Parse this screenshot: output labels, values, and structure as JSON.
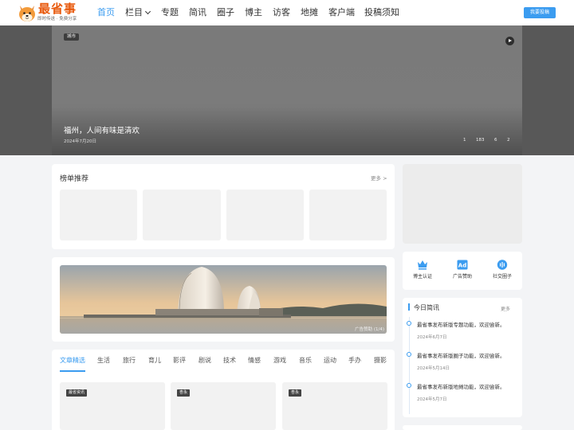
{
  "logo": {
    "title": "最省事",
    "slogan": "即时传送 · 免费分享"
  },
  "nav": {
    "items": [
      {
        "label": "首页",
        "active": true
      },
      {
        "label": "栏目",
        "has_dropdown": true
      },
      {
        "label": "专题"
      },
      {
        "label": "简讯"
      },
      {
        "label": "圈子"
      },
      {
        "label": "博主"
      },
      {
        "label": "访客"
      },
      {
        "label": "地摊"
      },
      {
        "label": "客户端"
      },
      {
        "label": "投稿须知"
      }
    ],
    "submit_button": "我要投稿"
  },
  "hero": {
    "tag": "城市",
    "title": "福州，人间有味是清欢",
    "date": "2024年7月20日",
    "stats": [
      "1",
      "183",
      "6",
      "2"
    ]
  },
  "ranking": {
    "title": "榜单推荐",
    "more": "更多 >"
  },
  "ad_banner": {
    "label": "广告赞助 (1/4)"
  },
  "article_tabs": {
    "tabs": [
      "文章精选",
      "生活",
      "旅行",
      "育儿",
      "影评",
      "剧说",
      "技术",
      "情感",
      "游戏",
      "音乐",
      "运动",
      "手办",
      "摄影"
    ],
    "active_index": 0
  },
  "articles": [
    {
      "tag": "最省资讯"
    },
    {
      "tag": "杏永"
    },
    {
      "tag": "杏永"
    }
  ],
  "sidebar": {
    "quick_links": [
      {
        "label": "博主认证",
        "icon": "crown-icon"
      },
      {
        "label": "广告赞助",
        "icon": "ad-icon"
      },
      {
        "label": "社交圈子",
        "icon": "circle-voice-icon"
      }
    ],
    "briefs": {
      "title": "今日简讯",
      "more": "更多",
      "items": [
        {
          "text": "最省事发布新版专题功能，欢迎尝新。",
          "date": "2024年6月7日"
        },
        {
          "text": "最省事发布新版圈子功能，欢迎尝新。",
          "date": "2024年5月14日"
        },
        {
          "text": "最省事发布新版地摊功能，欢迎尝新。",
          "date": "2024年5月7日"
        }
      ]
    }
  },
  "colors": {
    "accent": "#3b9cf0",
    "logo": "#e8590c",
    "background": "#f3f4f6"
  }
}
